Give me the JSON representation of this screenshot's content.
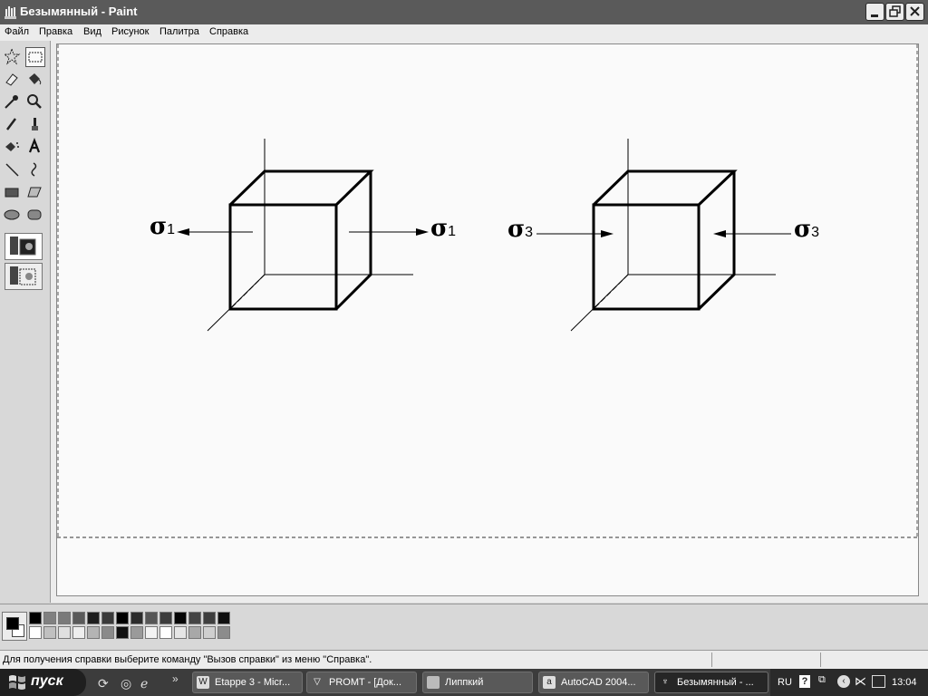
{
  "window": {
    "title": "Безымянный - Paint"
  },
  "menu": [
    "Файл",
    "Правка",
    "Вид",
    "Рисунок",
    "Палитра",
    "Справка"
  ],
  "drawing": {
    "sigma_symbol": "σ",
    "left_cube": {
      "subscript": "1"
    },
    "right_cube": {
      "subscript": "3"
    }
  },
  "palette": {
    "primary_color": "#000000",
    "secondary_color": "#ffffff",
    "row1": [
      "#000000",
      "#808080",
      "#7a7a7a",
      "#5a5a5a",
      "#1e1e1e",
      "#3a3a3a",
      "#000000",
      "#2c2c2c",
      "#565656",
      "#3c3c3c",
      "#050505",
      "#444444",
      "#3e3e3e",
      "#101010"
    ],
    "row2": [
      "#ffffff",
      "#c0c0c0",
      "#e0e0e0",
      "#eeeeee",
      "#b4b4b4",
      "#8a8a8a",
      "#101010",
      "#9a9a9a",
      "#f2f2f2",
      "#ffffff",
      "#e6e6e6",
      "#a8a8a8",
      "#cfcfcf",
      "#8c8c8c"
    ]
  },
  "status": {
    "help_text": "Для получения справки выберите команду \"Вызов справки\" из меню \"Справка\"."
  },
  "taskbar": {
    "start_label": "пуск",
    "chevron": "»",
    "tasks": [
      {
        "label": "Etappe 3 - Micr...",
        "icon": "word-icon"
      },
      {
        "label": "PROMT - [Док...",
        "icon": "promt-icon"
      },
      {
        "label": "Липпкий",
        "icon": "folder-icon"
      },
      {
        "label": "AutoCAD 2004...",
        "icon": "autocad-icon"
      },
      {
        "label": "Безымянный - ...",
        "icon": "paint-icon"
      }
    ],
    "tray": {
      "lang": "RU",
      "clock": "13:04"
    }
  }
}
